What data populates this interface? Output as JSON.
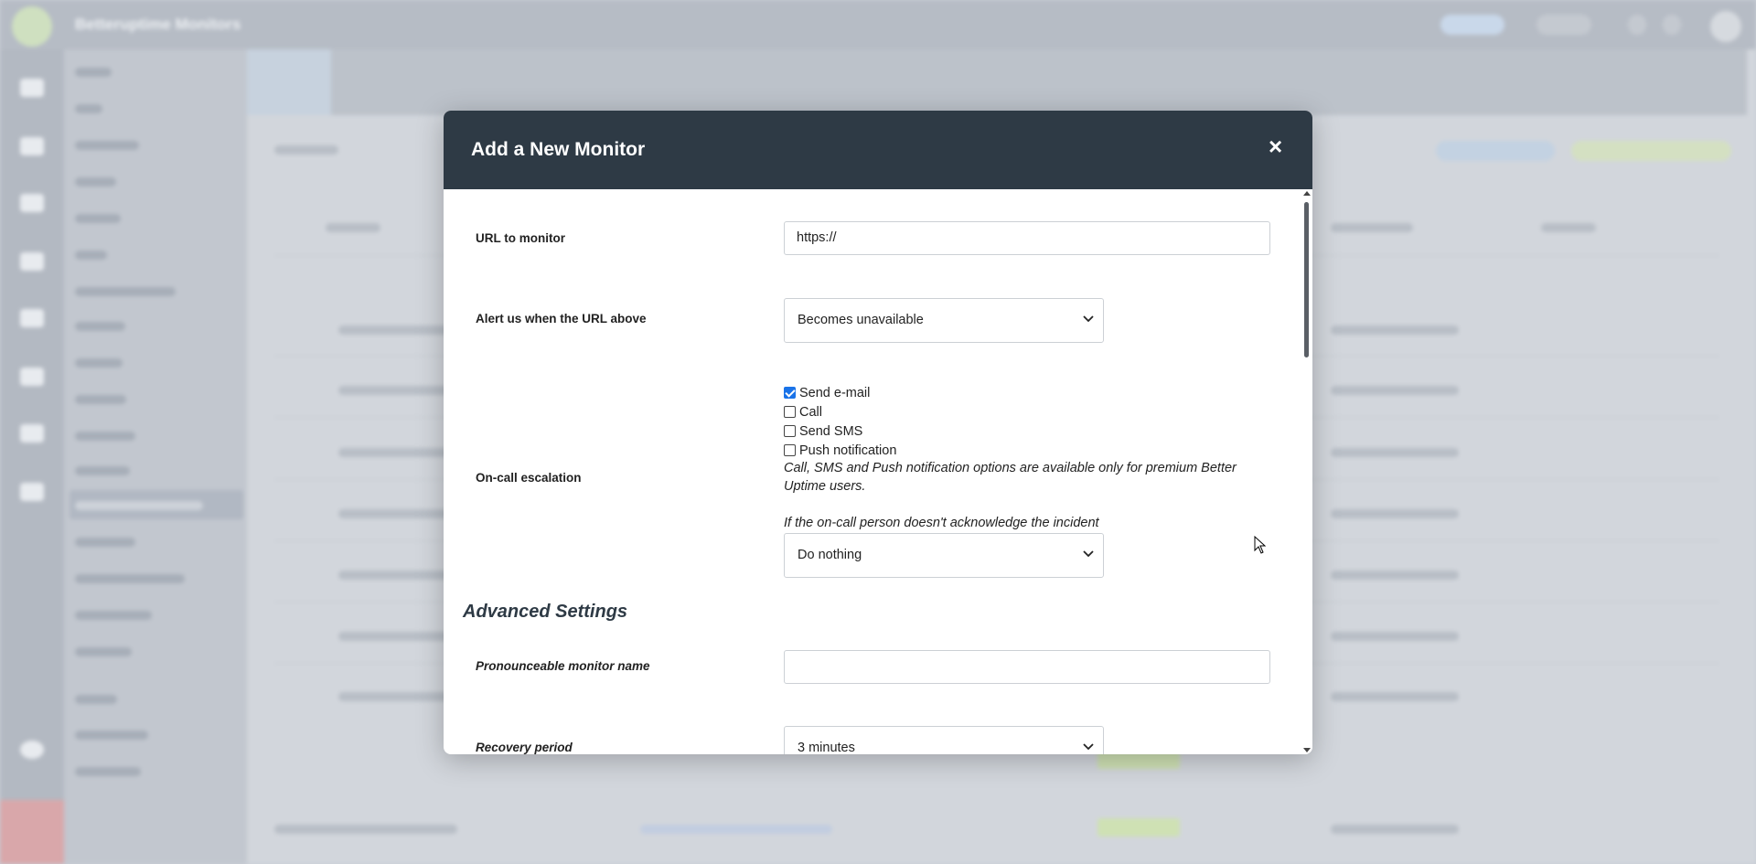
{
  "background": {
    "app_title": "Betteruptime Monitors"
  },
  "modal": {
    "title": "Add a New Monitor",
    "close_label": "×",
    "url": {
      "label": "URL to monitor",
      "value": "https://"
    },
    "alert": {
      "label": "Alert us when the URL above",
      "selected": "Becomes unavailable"
    },
    "escalation": {
      "label": "On-call escalation",
      "options": [
        {
          "label": "Send e-mail",
          "checked": true
        },
        {
          "label": "Call",
          "checked": false
        },
        {
          "label": "Send SMS",
          "checked": false
        },
        {
          "label": "Push notification",
          "checked": false
        }
      ],
      "premium_note": "Call, SMS and Push notification options are available only for premium Better Uptime users.",
      "ack_note": "If the on-call person doesn't acknowledge the incident",
      "ack_selected": "Do nothing"
    },
    "advanced": {
      "heading": "Advanced Settings",
      "pronounceable_label": "Pronounceable monitor name",
      "pronounceable_value": "",
      "recovery_label": "Recovery period",
      "recovery_selected": "3 minutes"
    }
  },
  "colors": {
    "header_bg": "#2e3a45",
    "checkbox_accent": "#1a73e8"
  }
}
